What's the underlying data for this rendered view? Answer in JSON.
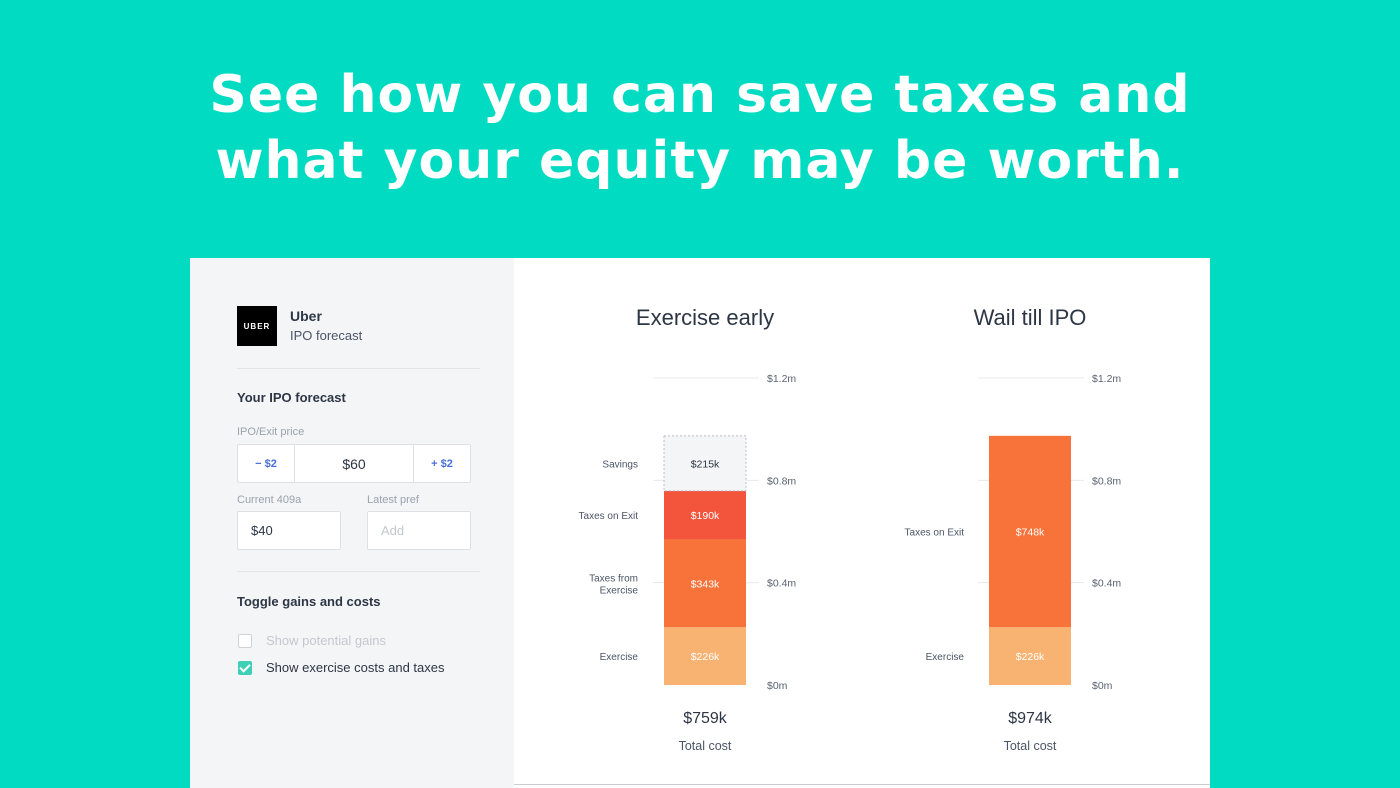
{
  "headline": {
    "line1": "See how you can save taxes and",
    "line2": "what your equity may be worth."
  },
  "sidebar": {
    "logo_text": "UBER",
    "company": "Uber",
    "subtitle": "IPO forecast",
    "forecast_title": "Your IPO forecast",
    "ipo_price_label": "IPO/Exit price",
    "minus_label": "− $2",
    "price_value": "$60",
    "plus_label": "+ $2",
    "current_409a_label": "Current 409a",
    "current_409a_value": "$40",
    "latest_pref_label": "Latest pref",
    "latest_pref_placeholder": "Add",
    "toggle_title": "Toggle gains and costs",
    "toggles": [
      {
        "label": "Show potential gains",
        "checked": false
      },
      {
        "label": "Show exercise costs and taxes",
        "checked": true
      }
    ]
  },
  "colors": {
    "background": "#00dbc1",
    "savings": "#f4f5f7",
    "taxes_on_exit": "#f2553c",
    "taxes_from_exercise": "#f7733a",
    "exercise": "#f8b373",
    "checkbox": "#3fcfb6"
  },
  "chart_data": [
    {
      "type": "bar",
      "title": "Exercise early",
      "ylim": [
        0,
        1.2
      ],
      "yticks": [
        "$0m",
        "$0.4m",
        "$0.8m",
        "$1.2m"
      ],
      "segments": [
        {
          "name": "Exercise",
          "value": 226,
          "label": "$226k",
          "color": "#f8b373"
        },
        {
          "name": "Taxes from Exercise",
          "value": 343,
          "label": "$343k",
          "color": "#f7733a"
        },
        {
          "name": "Taxes on Exit",
          "value": 190,
          "label": "$190k",
          "color": "#f2553c"
        },
        {
          "name": "Savings",
          "value": 215,
          "label": "$215k",
          "color": "#f4f5f7",
          "dashed": true
        }
      ],
      "total": "$759k",
      "total_label": "Total cost"
    },
    {
      "type": "bar",
      "title": "Wail till IPO",
      "ylim": [
        0,
        1.2
      ],
      "yticks": [
        "$0m",
        "$0.4m",
        "$0.8m",
        "$1.2m"
      ],
      "segments": [
        {
          "name": "Exercise",
          "value": 226,
          "label": "$226k",
          "color": "#f8b373"
        },
        {
          "name": "Taxes on Exit",
          "value": 748,
          "label": "$748k",
          "color": "#f7733a"
        }
      ],
      "total": "$974k",
      "total_label": "Total cost"
    }
  ]
}
